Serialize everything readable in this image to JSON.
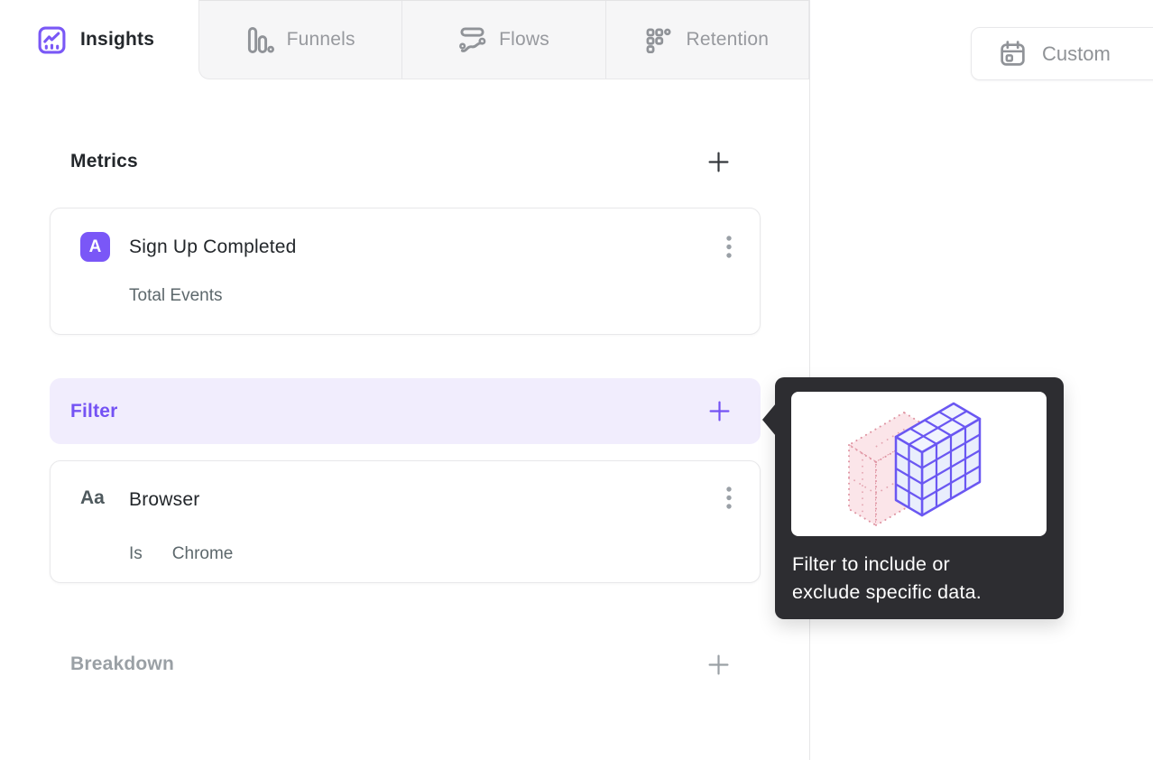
{
  "tabs": [
    {
      "label": "Insights",
      "active": true,
      "icon": "line-chart-icon"
    },
    {
      "label": "Funnels",
      "active": false,
      "icon": "funnel-bars-icon"
    },
    {
      "label": "Flows",
      "active": false,
      "icon": "flows-icon"
    },
    {
      "label": "Retention",
      "active": false,
      "icon": "retention-grid-icon"
    }
  ],
  "toolbar": {
    "custom_label": "Custom",
    "custom_icon": "calendar-icon"
  },
  "metrics_section": {
    "title": "Metrics",
    "add_icon": "plus-icon"
  },
  "metric_card": {
    "badge": "A",
    "title": "Sign Up Completed",
    "subtitle": "Total Events",
    "menu_icon": "kebab-menu-icon"
  },
  "filter_section": {
    "title": "Filter",
    "add_icon": "plus-icon"
  },
  "filter_card": {
    "badge": "Aa",
    "title": "Browser",
    "operator": "Is",
    "value": "Chrome",
    "menu_icon": "kebab-menu-icon"
  },
  "breakdown_section": {
    "title": "Breakdown",
    "add_icon": "plus-icon"
  },
  "tooltip": {
    "line1": "Filter to include or",
    "line2": "exclude specific data.",
    "illustration": "isometric-cubes-filter-illustration"
  },
  "colors": {
    "accent_purple": "#7856FF",
    "filter_bar_bg": "#F1EDFD",
    "badge_purple": "#7A57F7",
    "tooltip_bg": "#2D2D31",
    "inactive_tab_bg": "#F6F6F7",
    "card_border": "#E8E8EA",
    "muted_text": "#5D686C",
    "gray_text": "#97999E",
    "illustration_pink": "#FBE4E8",
    "illustration_purple": "#6A57F2"
  }
}
